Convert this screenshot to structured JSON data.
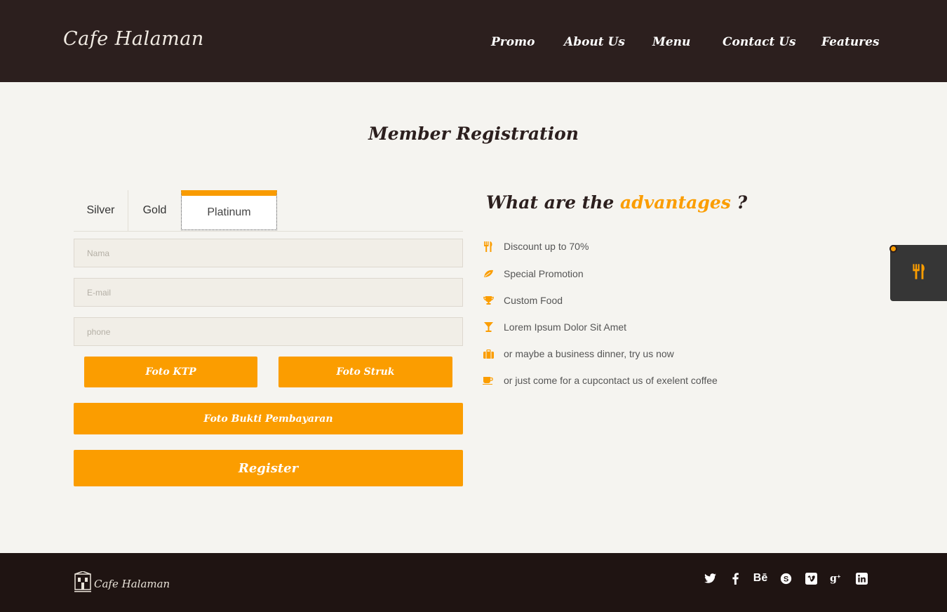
{
  "header": {
    "logo": "Cafe Halaman",
    "nav": [
      "Promo",
      "About Us",
      "Menu",
      "Contact Us",
      "Features"
    ]
  },
  "page_title": "Member Registration",
  "tabs": {
    "items": [
      "Silver",
      "Gold",
      "Platinum"
    ],
    "active": "Platinum"
  },
  "form": {
    "name_placeholder": "Nama",
    "email_placeholder": "E-mail",
    "phone_placeholder": "phone",
    "foto_ktp": "Foto KTP",
    "foto_struk": "Foto Struk",
    "foto_bukti": "Foto Bukti Pembayaran",
    "register": "Register"
  },
  "advantages": {
    "title_prefix": "What are the",
    "title_highlight": "advantages",
    "title_suffix": "?",
    "items": [
      {
        "icon": "cutlery-icon",
        "text": "Discount up to 70%"
      },
      {
        "icon": "leaf-icon",
        "text": "Special Promotion"
      },
      {
        "icon": "trophy-icon",
        "text": "Custom Food"
      },
      {
        "icon": "cocktail-icon",
        "text": "Lorem Ipsum Dolor Sit Amet"
      },
      {
        "icon": "briefcase-icon",
        "text": "or maybe a business dinner, try us now"
      },
      {
        "icon": "coffee-icon",
        "text": "or just come for a cupcontact us of exelent coffee"
      }
    ]
  },
  "footer": {
    "logo": "Cafe Halaman",
    "social": [
      "twitter-icon",
      "facebook-icon",
      "behance-icon",
      "skype-icon",
      "vimeo-icon",
      "google-plus-icon",
      "linkedin-icon"
    ]
  },
  "colors": {
    "accent": "#fb9d00",
    "header_bg": "#2c1f1e",
    "footer_bg": "#1f1412",
    "page_bg": "#f5f4f0"
  }
}
